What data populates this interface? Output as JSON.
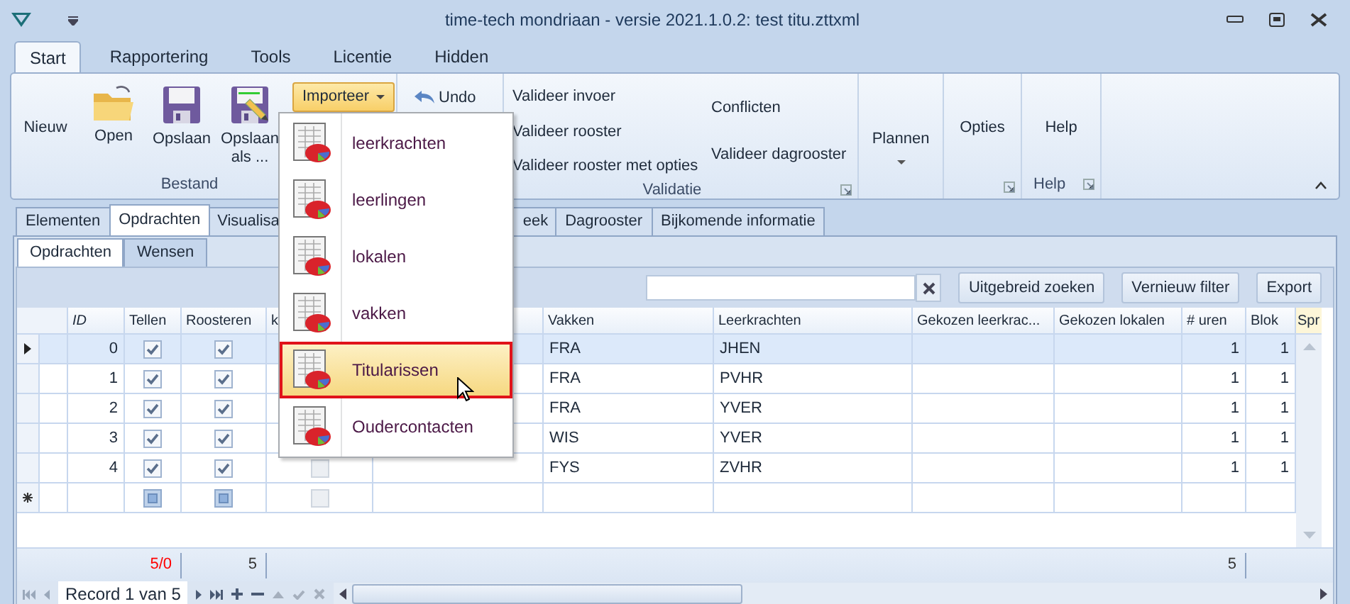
{
  "window": {
    "title": "time-tech mondriaan - versie 2021.1.0.2: test titu.zttxml"
  },
  "ribbon_tabs": [
    {
      "label": "Start",
      "selected": true
    },
    {
      "label": "Rapportering",
      "selected": false
    },
    {
      "label": "Tools",
      "selected": false
    },
    {
      "label": "Licentie",
      "selected": false
    },
    {
      "label": "Hidden",
      "selected": false
    }
  ],
  "ribbon": {
    "bestand": {
      "label": "Bestand",
      "buttons": [
        {
          "label": "Nieuw",
          "kind": "text"
        },
        {
          "label": "Open",
          "kind": "folder"
        },
        {
          "label": "Opslaan",
          "kind": "floppy"
        },
        {
          "label": "Opslaan als ...",
          "kind": "floppy_pencil"
        }
      ],
      "dropdown": {
        "label": "Importeer",
        "expanded": true
      }
    },
    "undo": {
      "label": "Undo"
    },
    "validatie": {
      "label": "Validatie",
      "column_1": [
        "Valideer invoer",
        "Valideer rooster",
        "Valideer rooster met opties"
      ],
      "column_2": [
        "Conflicten",
        "Valideer dagrooster"
      ]
    },
    "plannen": {
      "label": "Plannen"
    },
    "opties": {
      "label": "Opties"
    },
    "help": {
      "button": "Help",
      "label": "Help"
    }
  },
  "import_menu": [
    {
      "label": "leerkrachten",
      "selected": false
    },
    {
      "label": "leerlingen",
      "selected": false
    },
    {
      "label": "lokalen",
      "selected": false
    },
    {
      "label": "vakken",
      "selected": false
    },
    {
      "label": "Titularissen",
      "selected": true
    },
    {
      "label": "Oudercontacten",
      "selected": false
    }
  ],
  "content_tabs": [
    {
      "label": "Elementen",
      "selected": false
    },
    {
      "label": "Opdrachten",
      "selected": true
    },
    {
      "label": "Visualisa",
      "selected": false
    },
    {
      "label": "eek",
      "selected": false
    },
    {
      "label": "Dagrooster",
      "selected": false
    },
    {
      "label": "Bijkomende informatie",
      "selected": false
    }
  ],
  "sub_tabs": [
    {
      "label": "Opdrachten",
      "selected": true
    },
    {
      "label": "Wensen",
      "selected": false
    }
  ],
  "toolbar": {
    "buttons": [
      "Uitgebreid zoeken",
      "Vernieuw filter",
      "Export"
    ]
  },
  "grid": {
    "columns": [
      "ID",
      "Tellen",
      "Roosteren",
      "k",
      "Vakken",
      "Leerkrachten",
      "Gekozen leerkrac...",
      "Gekozen lokalen",
      "# uren",
      "Blok"
    ],
    "cut_column": "Spr",
    "rows": [
      {
        "selected": true,
        "id": "0",
        "tellen_checked": true,
        "roosteren_checked": true,
        "vakken": "FRA",
        "leerkrachten": "JHEN",
        "uren": "1",
        "blok": "1"
      },
      {
        "selected": false,
        "id": "1",
        "tellen_checked": true,
        "roosteren_checked": true,
        "vakken": "FRA",
        "leerkrachten": "PVHR",
        "uren": "1",
        "blok": "1"
      },
      {
        "selected": false,
        "id": "2",
        "tellen_checked": true,
        "roosteren_checked": true,
        "vakken": "FRA",
        "leerkrachten": "YVER",
        "uren": "1",
        "blok": "1"
      },
      {
        "selected": false,
        "id": "3",
        "tellen_checked": true,
        "roosteren_checked": true,
        "vakken": "WIS",
        "leerkrachten": "YVER",
        "uren": "1",
        "blok": "1"
      },
      {
        "selected": false,
        "id": "4",
        "tellen_checked": true,
        "roosteren_checked": true,
        "column_4": {
          "checked": false,
          "disabled": true
        },
        "vakken": "FYS",
        "leerkrachten": "ZVHR",
        "uren": "1",
        "blok": "1"
      }
    ],
    "new_row": {
      "tellen_checked": false,
      "roosteren_checked": false,
      "column_4": {
        "checked": false,
        "disabled": true
      }
    },
    "summary": {
      "tellen": {
        "text": "5/0",
        "highlighted": true
      },
      "roosteren": {
        "text": "5",
        "highlighted": false
      },
      "uren": {
        "text": "5",
        "highlighted": false
      }
    }
  },
  "navigator": {
    "record": "Record 1 van 5"
  }
}
